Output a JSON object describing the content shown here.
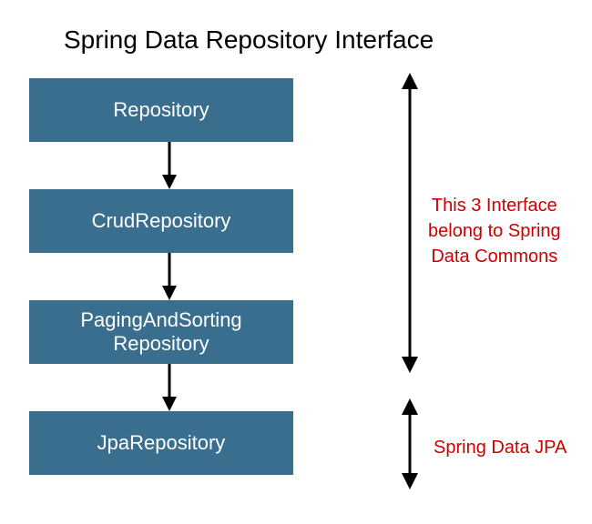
{
  "title": "Spring Data Repository Interface",
  "boxes": {
    "b1": "Repository",
    "b2": "CrudRepository",
    "b3_line1": "PagingAndSorting",
    "b3_line2": "Repository",
    "b4": "JpaRepository"
  },
  "annotations": {
    "a1_line1": "This 3 Interface",
    "a1_line2": "belong to Spring",
    "a1_line3": "Data Commons",
    "a2": "Spring Data JPA"
  },
  "colors": {
    "box_bg": "#3a6e8f",
    "box_text": "#ffffff",
    "annotation_text": "#cc0000"
  }
}
